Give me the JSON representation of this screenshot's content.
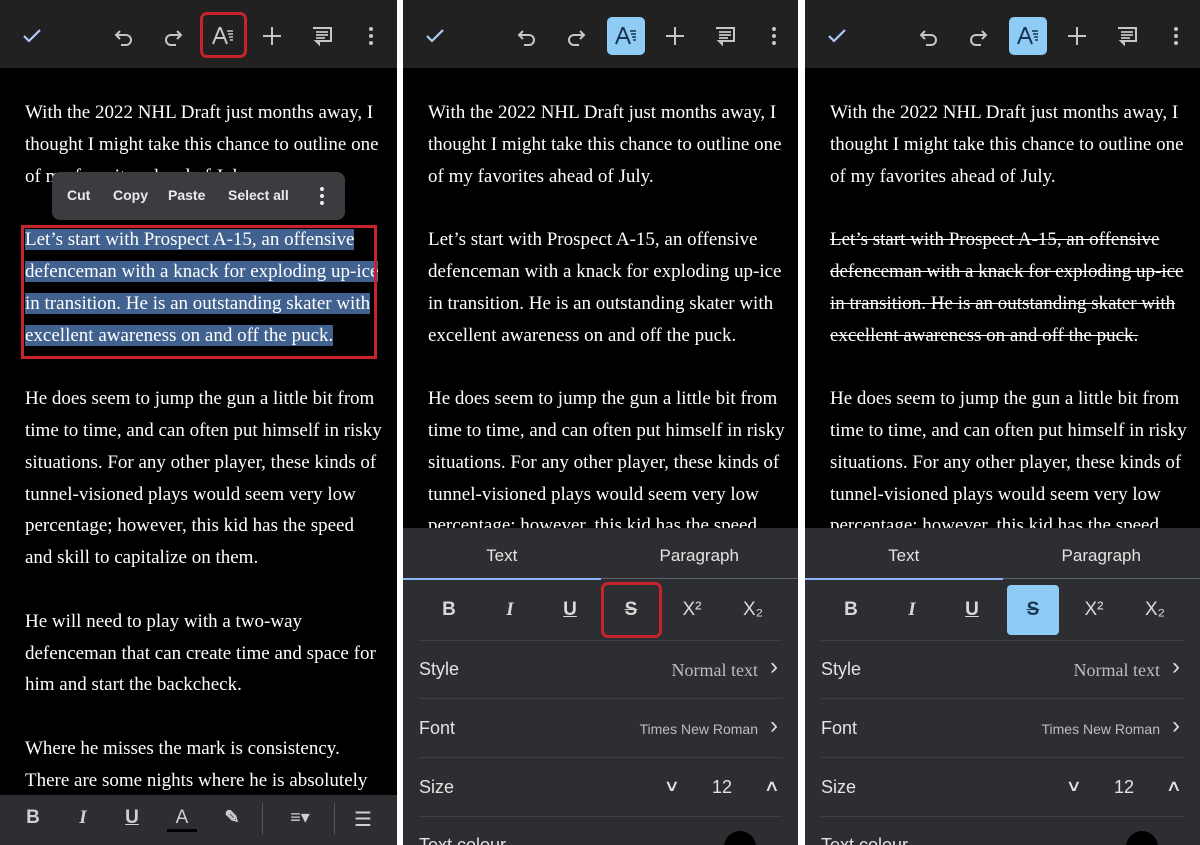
{
  "colors": {
    "accent": "#8ecbf5",
    "highlight_box": "#c8232c",
    "selection": "#41618f"
  },
  "toolbar": {
    "icons": [
      "check-icon",
      "undo-icon",
      "redo-icon",
      "text-format-icon",
      "plus-icon",
      "comment-icon",
      "more-vert-icon"
    ]
  },
  "document": {
    "paragraphs": [
      [
        "With the 2022 NHL Draft just months away, I",
        "thought I might take this chance to outline one",
        "of my favorites ahead of July."
      ],
      [
        "Let’s start with Prospect A-15, an offensive",
        "defenceman with a knack for exploding up-ice",
        "in transition. He is an outstanding skater with",
        "excellent awareness on and off the puck."
      ],
      [
        "He does seem to jump the gun a little bit from",
        "time to time, and can often put himself in risky",
        "situations. For any other player, these kinds of",
        "tunnel-visioned plays would seem very low",
        "percentage; however, this kid has the speed",
        "and skill to capitalize on them."
      ],
      [
        "He will need to play with a two-way",
        "defenceman that can create time and space for",
        "him and start the backcheck."
      ],
      [
        "Where he misses the mark is consistency.",
        "There are some nights where he is absolutely"
      ]
    ]
  },
  "context_menu": {
    "cut": "Cut",
    "copy": "Copy",
    "paste": "Paste",
    "select_all": "Select all"
  },
  "bottom_toolbar": {
    "bold": "B",
    "italic": "I",
    "underline": "U",
    "text_color": "A"
  },
  "format_panel": {
    "tabs": [
      "Text",
      "Paragraph"
    ],
    "buttons": [
      "B",
      "I",
      "U",
      "S",
      "X²",
      "X₂"
    ],
    "style_label": "Style",
    "style_value": "Normal text",
    "font_label": "Font",
    "font_value": "Times New Roman",
    "size_label": "Size",
    "size_value": "12",
    "text_colour_label": "Text colour"
  }
}
